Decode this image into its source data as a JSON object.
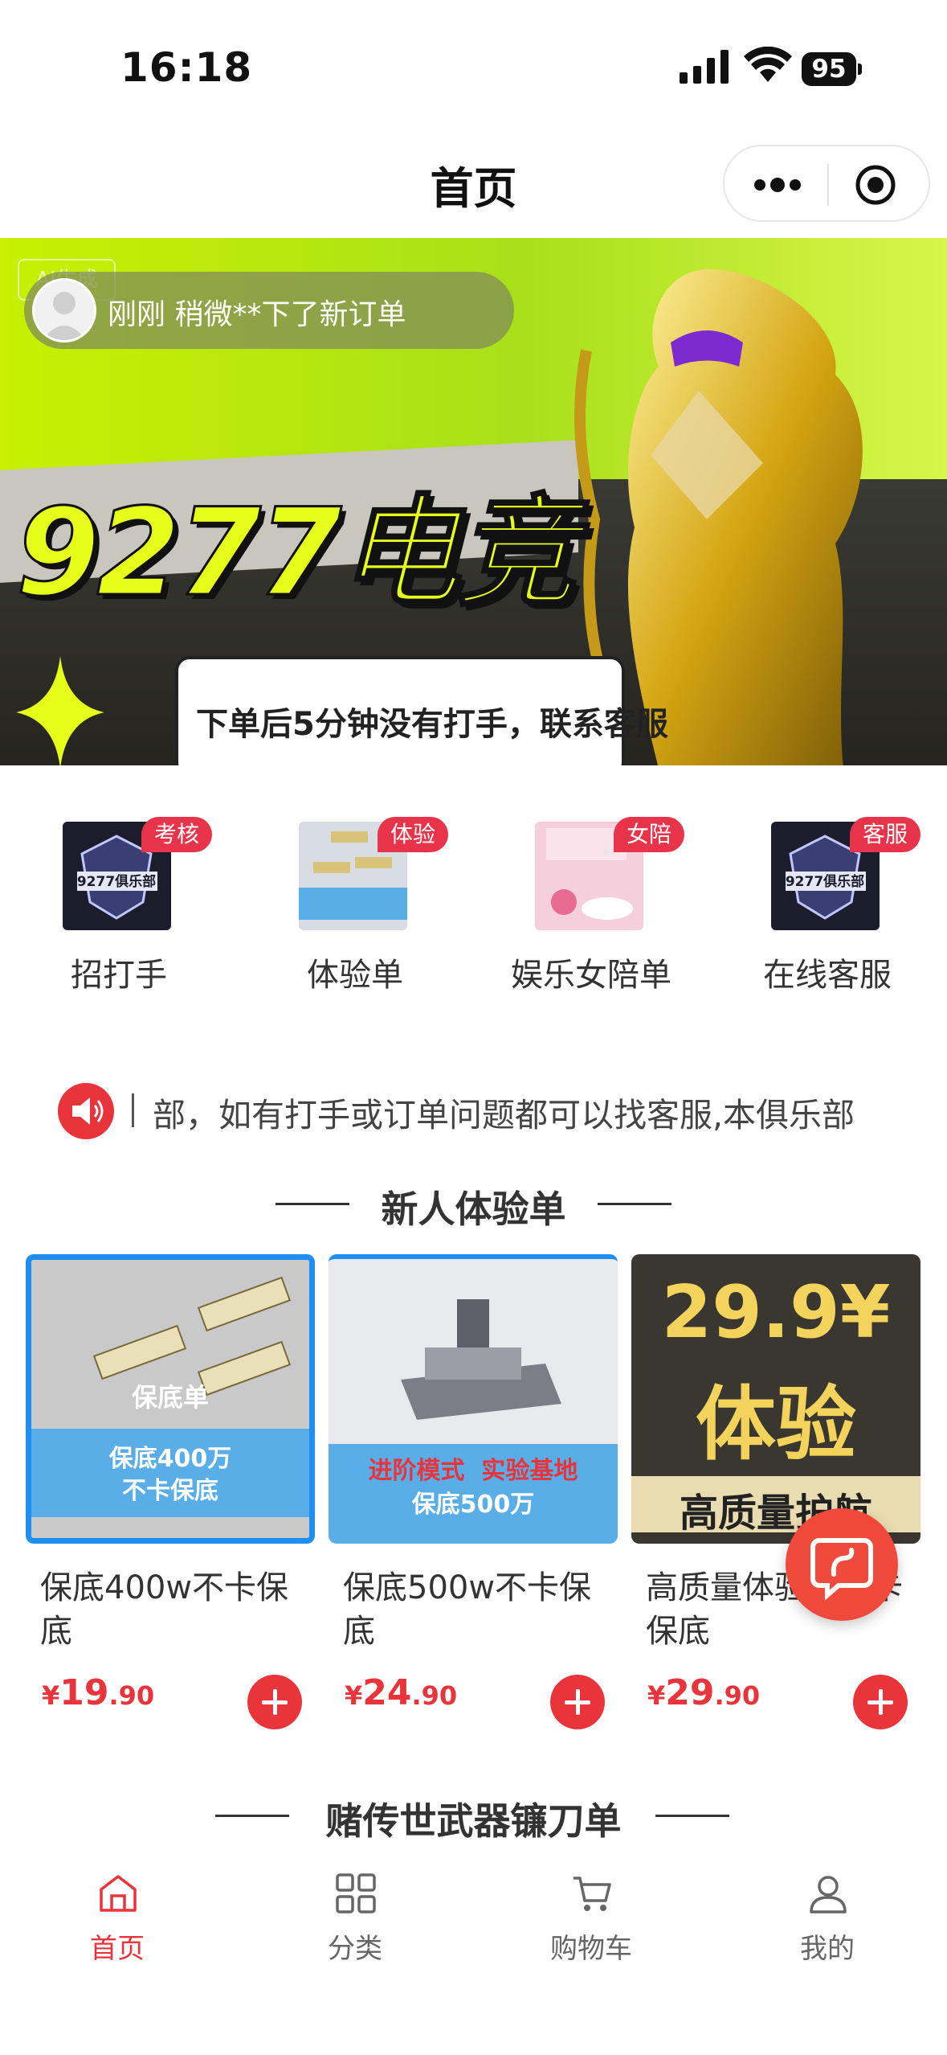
{
  "status_bar": {
    "time": "16:18",
    "battery": "95"
  },
  "nav": {
    "title": "首页"
  },
  "banner": {
    "brand": "9277电竞",
    "tip": "下单后5分钟没有打手，联系客服",
    "corner": "AI生成",
    "toast": "刚刚  稍微**下了新订单"
  },
  "quick_menu": [
    {
      "label": "招打手",
      "badge": "考核",
      "icon": "club-logo-icon"
    },
    {
      "label": "体验单",
      "badge": "体验",
      "icon": "gold-bars-icon"
    },
    {
      "label": "娱乐女陪单",
      "badge": "女陪",
      "icon": "female-companion-icon"
    },
    {
      "label": "在线客服",
      "badge": "客服",
      "icon": "club-logo-icon"
    }
  ],
  "notice": {
    "text": "部，如有打手或订单问题都可以找客服,本俱乐部"
  },
  "sections": {
    "new_user": "新人体验单",
    "weapons": "赌传世武器镰刀单"
  },
  "products": [
    {
      "name": "保底400w不卡保底",
      "currency": "¥",
      "price_int": "19",
      "price_dec": ".90",
      "img_title": "保底单",
      "img_line1": "保底400万",
      "img_line2": "不卡保底"
    },
    {
      "name": "保底500w不卡保底",
      "currency": "¥",
      "price_int": "24",
      "price_dec": ".90",
      "img_line1": "进阶模式  实验基地",
      "img_line2": "保底500万"
    },
    {
      "name": "高质量体验单不卡保底",
      "currency": "¥",
      "price_int": "29",
      "price_dec": ".90",
      "img_line1": "29.9¥",
      "img_line2": "体验",
      "img_line3": "高质量护航"
    }
  ],
  "tabbar": [
    {
      "label": "首页",
      "icon": "home-icon",
      "active": true
    },
    {
      "label": "分类",
      "icon": "category-grid-icon",
      "active": false
    },
    {
      "label": "购物车",
      "icon": "cart-icon",
      "active": false
    },
    {
      "label": "我的",
      "icon": "user-icon",
      "active": false
    }
  ],
  "colors": {
    "accent": "#e8343a",
    "badge": "#e8344a",
    "banner_lime": "#c8f000"
  }
}
